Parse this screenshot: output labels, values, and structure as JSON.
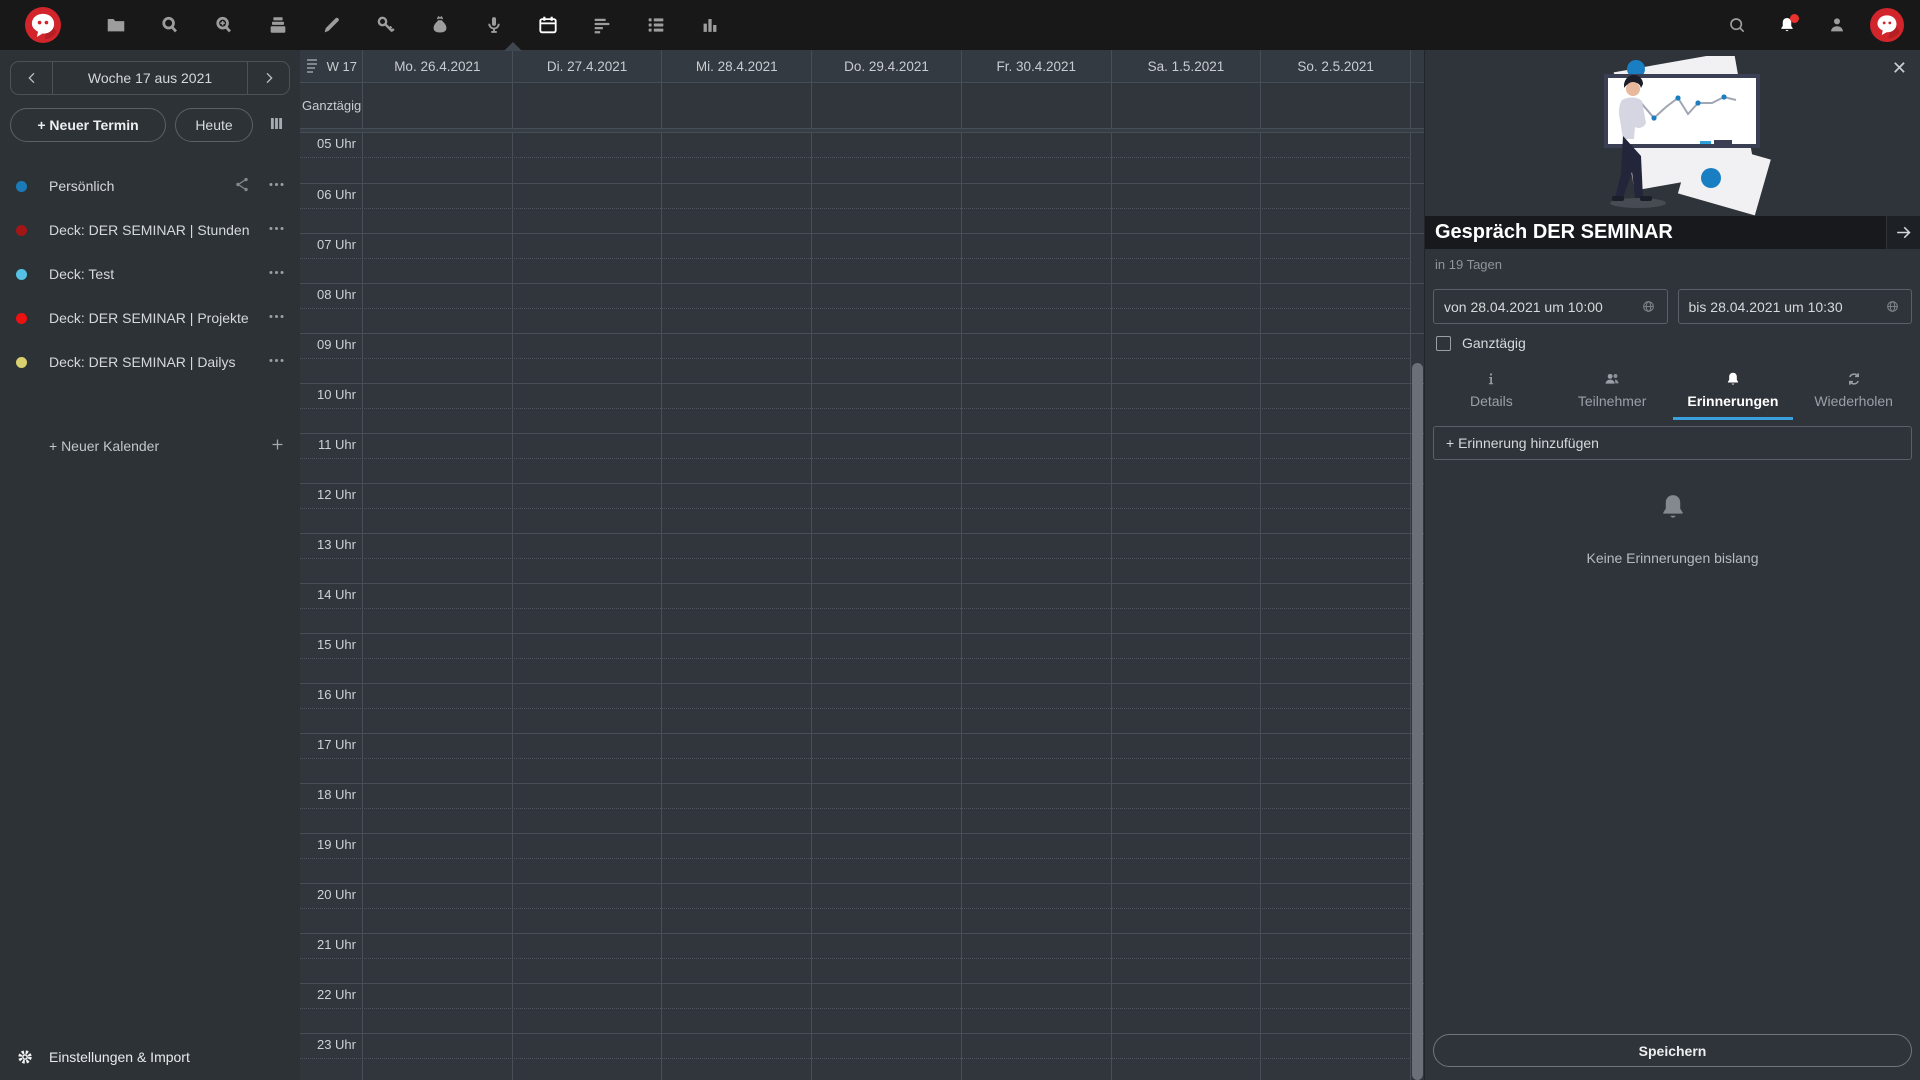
{
  "colors": {
    "accent": "#3ba0dc",
    "logo_red": "#d2252b",
    "badge_red": "#e9322d",
    "scrollbar": "#6b7077"
  },
  "topbar": {
    "app_icons": [
      "folder",
      "search",
      "search-plus",
      "archive",
      "pencil",
      "key",
      "money-bag",
      "microphone",
      "calendar",
      "align-left",
      "bullet-list",
      "bar-chart"
    ],
    "active_icon": "calendar",
    "right_icons": [
      "search",
      "bell",
      "contacts",
      "avatar"
    ],
    "notification_badge": true
  },
  "sidebar": {
    "week_label": "Woche 17 aus 2021",
    "new_event_label": "+ Neuer Termin",
    "today_label": "Heute",
    "calendars": [
      {
        "name": "Persönlich",
        "color": "#1b7ab8",
        "shared": true
      },
      {
        "name": "Deck: DER SEMINAR | Stunden",
        "color": "#a31616",
        "shared": false
      },
      {
        "name": "Deck: Test",
        "color": "#55c1e4",
        "shared": false
      },
      {
        "name": "Deck: DER SEMINAR | Projekte",
        "color": "#ee1111",
        "shared": false
      },
      {
        "name": "Deck: DER SEMINAR | Dailys",
        "color": "#d9d06f",
        "shared": false
      }
    ],
    "new_calendar_label": "+ Neuer Kalender",
    "settings_label": "Einstellungen & Import"
  },
  "calendar": {
    "week_cell": "W 17",
    "allday_label": "Ganztägig",
    "days": [
      "Mo. 26.4.2021",
      "Di. 27.4.2021",
      "Mi. 28.4.2021",
      "Do. 29.4.2021",
      "Fr. 30.4.2021",
      "Sa. 1.5.2021",
      "So. 2.5.2021"
    ],
    "hours": [
      "05 Uhr",
      "06 Uhr",
      "07 Uhr",
      "08 Uhr",
      "09 Uhr",
      "10 Uhr",
      "11 Uhr",
      "12 Uhr",
      "13 Uhr",
      "14 Uhr",
      "15 Uhr",
      "16 Uhr",
      "17 Uhr",
      "18 Uhr",
      "19 Uhr",
      "20 Uhr",
      "21 Uhr",
      "22 Uhr",
      "23 Uhr"
    ]
  },
  "panel": {
    "title": "Gespräch DER SEMINAR",
    "relative_time": "in 19 Tagen",
    "from_value": "von 28.04.2021 um 10:00",
    "to_value": "bis 28.04.2021 um 10:30",
    "allday_label": "Ganztägig",
    "allday_checked": false,
    "tabs": [
      {
        "label": "Details",
        "icon": "info",
        "active": false
      },
      {
        "label": "Teilnehmer",
        "icon": "people",
        "active": false
      },
      {
        "label": "Erinnerungen",
        "icon": "bell",
        "active": true
      },
      {
        "label": "Wiederholen",
        "icon": "repeat",
        "active": false
      }
    ],
    "add_reminder_label": "+ Erinnerung hinzufügen",
    "empty_state": "Keine Erinnerungen bislang",
    "save_label": "Speichern",
    "close_glyph": "✕"
  }
}
